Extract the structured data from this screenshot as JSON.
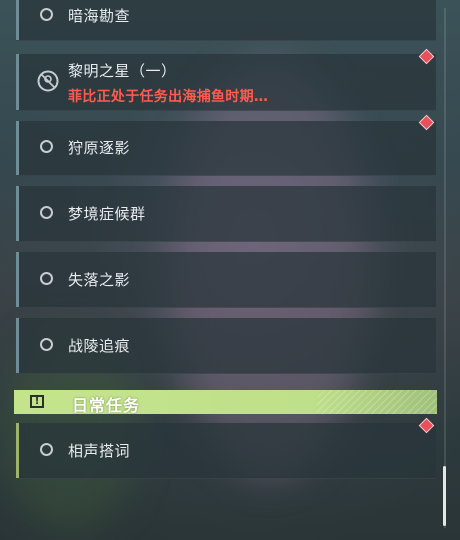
{
  "quests": [
    {
      "name": "暗海勘查"
    },
    {
      "name": "黎明之星（一）",
      "status": "菲比正处于任务出海捕鱼时期…"
    },
    {
      "name": "狩原逐影"
    },
    {
      "name": "梦境症候群"
    },
    {
      "name": "失落之影"
    },
    {
      "name": "战陵追痕"
    }
  ],
  "daily_section": {
    "title": "日常任务",
    "badge": "!"
  },
  "daily_quests": [
    {
      "name": "相声搭词"
    }
  ],
  "colors": {
    "accent_green": "#c4e48c",
    "alert_red": "#ff5a4f",
    "marker_red": "#e8505b"
  },
  "icons": [
    "ring-icon",
    "locked-clock-icon",
    "exclamation-icon",
    "diamond-marker-icon"
  ]
}
